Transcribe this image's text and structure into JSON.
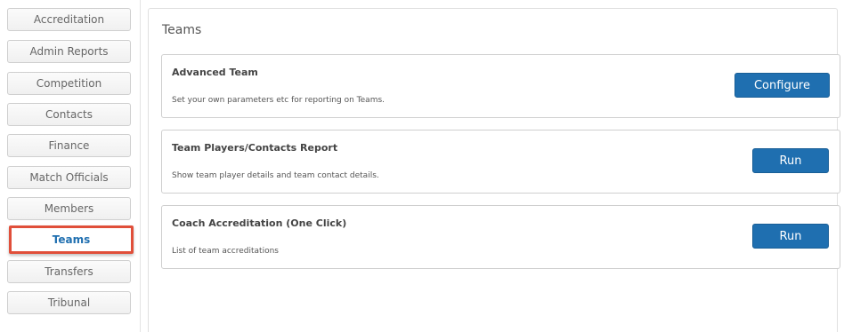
{
  "sidebar": {
    "items": [
      {
        "label": "Accreditation"
      },
      {
        "label": "Admin Reports"
      },
      {
        "label": "Competition"
      },
      {
        "label": "Contacts"
      },
      {
        "label": "Finance"
      },
      {
        "label": "Match Officials"
      },
      {
        "label": "Members"
      },
      {
        "label": "Teams",
        "active": true
      },
      {
        "label": "Transfers"
      },
      {
        "label": "Tribunal"
      }
    ]
  },
  "main": {
    "title": "Teams",
    "cards": [
      {
        "title": "Advanced Team",
        "description": "Set your own parameters etc for reporting on Teams.",
        "button": "Configure"
      },
      {
        "title": "Team Players/Contacts Report",
        "description": "Show team player details and team contact details.",
        "button": "Run"
      },
      {
        "title": "Coach Accreditation (One Click)",
        "description": "List of team accreditations",
        "button": "Run"
      }
    ]
  },
  "colors": {
    "accent_blue": "#1f6fb0",
    "highlight_red": "#e04f3a"
  }
}
